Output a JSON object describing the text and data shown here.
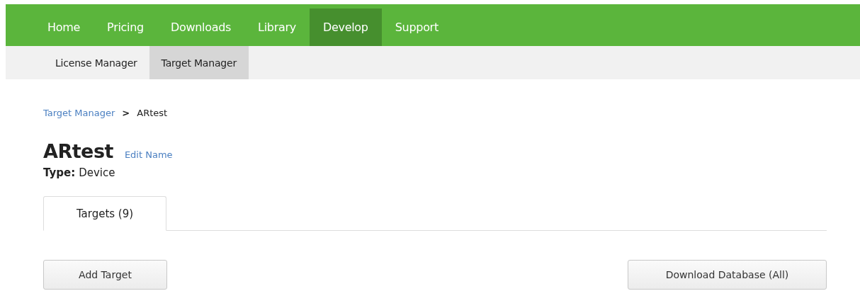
{
  "nav": [
    {
      "label": "Home",
      "selected": false
    },
    {
      "label": "Pricing",
      "selected": false
    },
    {
      "label": "Downloads",
      "selected": false
    },
    {
      "label": "Library",
      "selected": false
    },
    {
      "label": "Develop",
      "selected": true
    },
    {
      "label": "Support",
      "selected": false
    }
  ],
  "subnav": [
    {
      "label": "License Manager",
      "selected": false
    },
    {
      "label": "Target Manager",
      "selected": true
    }
  ],
  "breadcrumb": {
    "link": "Target Manager",
    "separator": ">",
    "current": "ARtest"
  },
  "title": "ARtest",
  "edit_link": "Edit Name",
  "type": {
    "label": "Type:",
    "value": "Device"
  },
  "tabs": [
    {
      "label": "Targets (9)",
      "selected": true
    }
  ],
  "buttons": {
    "left": "Add Target",
    "right": "Download Database (All)"
  }
}
